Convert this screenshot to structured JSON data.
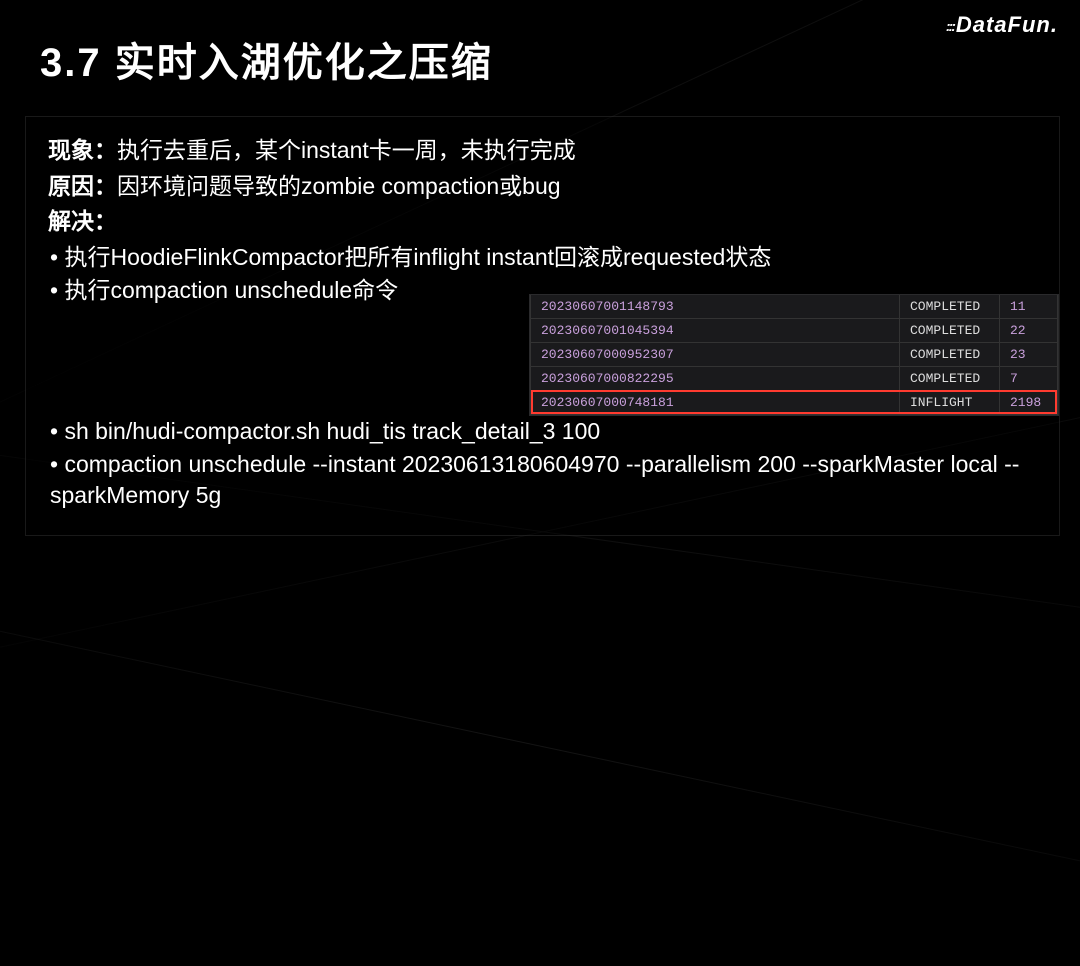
{
  "logo": "DataFun.",
  "title": "3.7 实时入湖优化之压缩",
  "phenomenon": {
    "label": "现象：",
    "text": "执行去重后，某个instant卡一周，未执行完成"
  },
  "cause": {
    "label": "原因：",
    "text": "因环境问题导致的zombie compaction或bug"
  },
  "solution": {
    "label": "解决："
  },
  "bullets_top": [
    "执行HoodieFlinkCompactor把所有inflight instant回滚成requested状态",
    "执行compaction unschedule命令"
  ],
  "bullets_bottom": [
    "sh bin/hudi-compactor.sh hudi_tis track_detail_3 100",
    "compaction unschedule --instant 20230613180604970  --parallelism 200 --sparkMaster local --sparkMemory 5g"
  ],
  "table_rows": [
    {
      "instant": "20230607001148793",
      "status": "COMPLETED",
      "value": "11",
      "partial": true
    },
    {
      "instant": "20230607001045394",
      "status": "COMPLETED",
      "value": "22"
    },
    {
      "instant": "20230607000952307",
      "status": "COMPLETED",
      "value": "23"
    },
    {
      "instant": "20230607000822295",
      "status": "COMPLETED",
      "value": "7"
    },
    {
      "instant": "20230607000748181",
      "status": "INFLIGHT",
      "value": "2198",
      "highlighted": true
    }
  ]
}
